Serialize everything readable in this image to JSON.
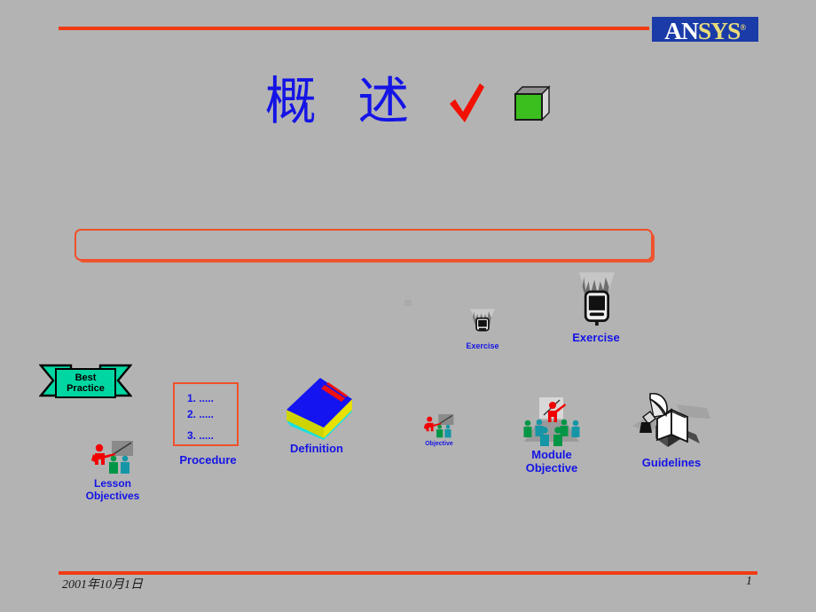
{
  "slide": {
    "title": "概 述",
    "logo": {
      "part1": "AN",
      "part2": "SYS",
      "tm": "®",
      "bg_color": "#1b3ba8",
      "part1_color": "#ffffff",
      "part2_color": "#e8dc7a"
    },
    "accent_color": "#f03b14",
    "title_color": "#1414e6",
    "background_color": "#b3b3b3",
    "title_icons": {
      "check": "check-mark-icon",
      "cube": "green-cube-icon"
    },
    "content_box": {
      "text": "",
      "border_color": "#f0502a"
    },
    "footer": {
      "date": "2001年10月1日",
      "page": "1"
    }
  },
  "icons": [
    {
      "id": "best-practice",
      "label": "Best\nPractice",
      "icon_name": "ribbon-banner-icon",
      "label_color": "#000000",
      "fill_color": "#00d6a2"
    },
    {
      "id": "lesson-objectives",
      "label": "Lesson\nObjectives",
      "icon_name": "instructor-class-icon",
      "label_color": "#1414e6"
    },
    {
      "id": "procedure",
      "label": "Procedure",
      "icon_name": "numbered-list-box-icon",
      "label_color": "#1414e6",
      "lines": [
        "1. .....",
        "2. .....",
        "3. ....."
      ]
    },
    {
      "id": "definition",
      "label": "Definition",
      "icon_name": "blue-book-icon",
      "label_color": "#1414e6"
    },
    {
      "id": "objective-small",
      "label": "Objective",
      "icon_name": "instructor-class-small-icon",
      "label_color": "#1414e6"
    },
    {
      "id": "module-objective",
      "label": "Module\nObjective",
      "icon_name": "classroom-audience-icon",
      "label_color": "#1414e6"
    },
    {
      "id": "guidelines",
      "label": "Guidelines",
      "icon_name": "quill-and-book-icon",
      "label_color": "#1414e6"
    },
    {
      "id": "exercise-small",
      "label": "Exercise",
      "icon_name": "computer-hands-small-icon",
      "label_color": "#1414e6"
    },
    {
      "id": "exercise-large",
      "label": "Exercise",
      "icon_name": "computer-hands-icon",
      "label_color": "#1414e6"
    }
  ]
}
